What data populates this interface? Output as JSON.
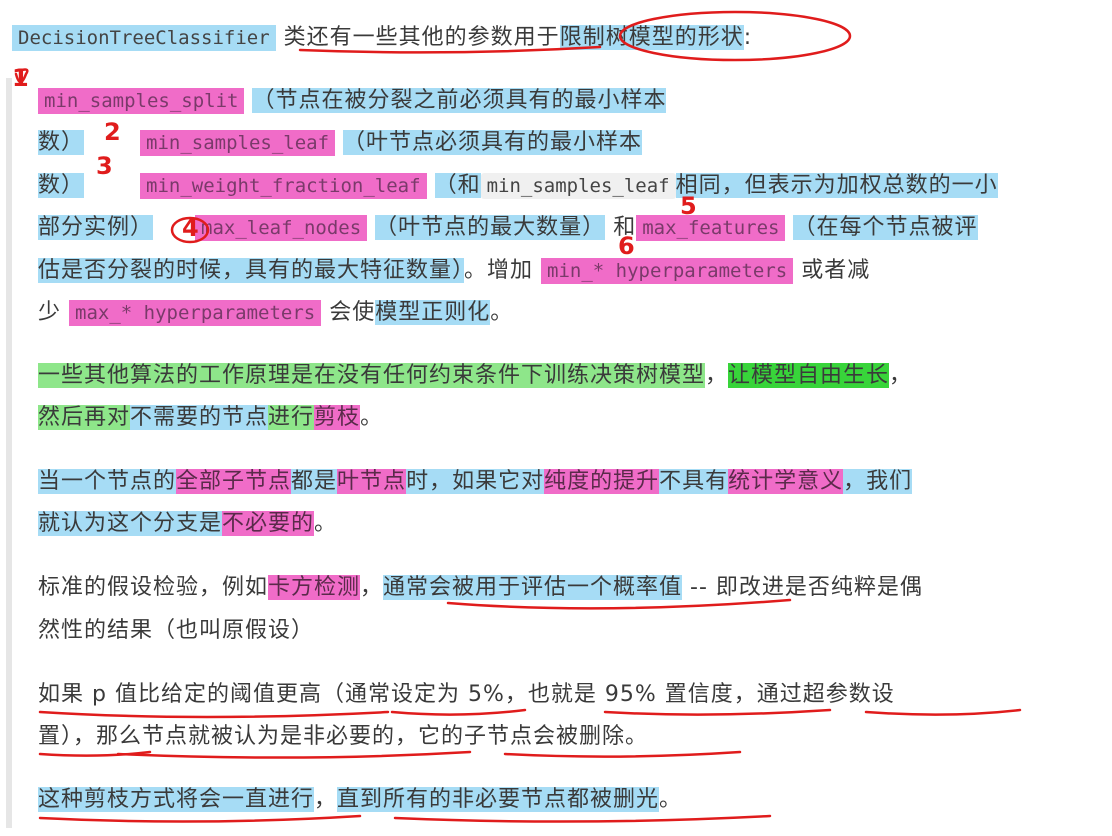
{
  "intro": {
    "code": "DecisionTreeClassifier",
    "t1": "类还有一些其他的参数用于",
    "t2": "限制树模型的形状",
    "t3": ":"
  },
  "params": {
    "mss": "min_samples_split",
    "mss_desc_a": "（节点在被分裂之前必须具有的最小样本",
    "mss_desc_b": "数）",
    "msl": "min_samples_leaf",
    "msl_desc_a": "（叶节点必须具有的最小样本",
    "msl_desc_b": "数）",
    "mwfl": "min_weight_fraction_leaf",
    "mwfl_desc_a": "（和",
    "mwfl_ref": "min_samples_leaf",
    "mwfl_desc_b": "相同，",
    "mwfl_desc_c": "但表示为加权总数的一小",
    "mwfl_desc_d": "部分实例）",
    "mln": "max_leaf_nodes",
    "mln_desc": "（叶节点的最大数量）",
    "and": "和",
    "mf": "max_features",
    "mf_desc_a": "（在每个节点被评",
    "mf_desc_b": "估是否分裂的时候，具有的最大特征数量）",
    "inc": "。增加",
    "min_hp": "min_* hyperparameters",
    "or": "或者减",
    "dec": "少",
    "max_hp": "max_* hyperparameters",
    "will": "会使",
    "reg": "模型正则化",
    "end": "。"
  },
  "p2": {
    "a": "一些其他算法的工作原理是在没有任何约束条件下训练决策树模型",
    "comma": "，",
    "b": "让模型自由生长",
    "comma2": "，",
    "c": "然后再对",
    "d": "不需要的节点",
    "e": "进行",
    "f": "剪枝",
    "g": "。"
  },
  "p3": {
    "a": "当一个节点的",
    "b": "全部子节点",
    "c": "都是",
    "d": "叶节点",
    "e": "时，如果它对",
    "f": "纯度的提升",
    "g": "不具有",
    "h": "统计学意义",
    "i": "，我们",
    "j": "就认为这个分支是",
    "k": "不必要的",
    "l": "。"
  },
  "p4": {
    "a": "标准的假设检验，例如",
    "b": "卡方检测",
    "c": "，",
    "d": "通常会被用于评估一个概率值",
    "e": " -- 即改进是否纯粹是偶",
    "f": "然性的结果（也叫原假设）"
  },
  "p5": {
    "a": "如果 p 值比给定的阈值更高（通常设定为 5%，也就是 95% 置信度，通过超参数设",
    "b": "置），那么节点就被认为是非必要的，它的子节点会被删除。"
  },
  "p6": {
    "a": "这种剪枝方式将会一直进行",
    "b": "，",
    "c": "直到所有的非必要节点都被删光",
    "d": "。"
  },
  "marks": [
    "1",
    "2",
    "3",
    "4",
    "5",
    "6"
  ],
  "colors": {
    "pink": "#f06cc8",
    "blue": "#a6dcf5",
    "green": "#8ee68a",
    "dark_green": "#38d43a",
    "red_ink": "#e01c1c"
  }
}
